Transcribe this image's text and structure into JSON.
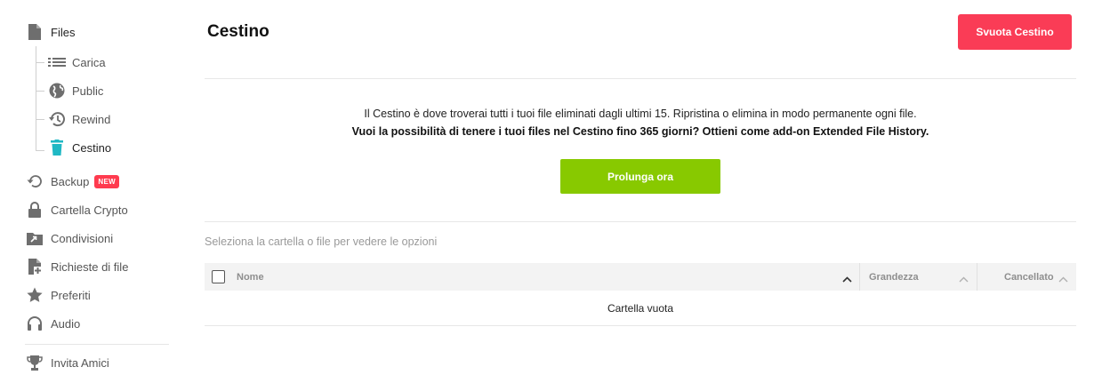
{
  "sidebar": {
    "files": {
      "label": "Files",
      "icon": "file-icon"
    },
    "sub_items": [
      {
        "label": "Carica",
        "icon": "list-icon"
      },
      {
        "label": "Public",
        "icon": "globe-icon"
      },
      {
        "label": "Rewind",
        "icon": "history-icon"
      },
      {
        "label": "Cestino",
        "icon": "trash-icon",
        "active": true
      }
    ],
    "items": [
      {
        "label": "Backup",
        "icon": "backup-icon",
        "badge": "NEW"
      },
      {
        "label": "Cartella Crypto",
        "icon": "lock-icon"
      },
      {
        "label": "Condivisioni",
        "icon": "shared-folder-icon"
      },
      {
        "label": "Richieste di file",
        "icon": "file-request-icon"
      },
      {
        "label": "Preferiti",
        "icon": "star-icon"
      },
      {
        "label": "Audio",
        "icon": "headphones-icon"
      }
    ],
    "footer": {
      "label": "Invita Amici",
      "icon": "trophy-icon"
    }
  },
  "main": {
    "title": "Cestino",
    "empty_button": "Svuota Cestino",
    "info_line1": "Il Cestino è dove troverai tutti i tuoi file eliminati dagli ultimi 15. Ripristina o elimina in modo permanente ogni file.",
    "info_line2": "Vuoi la possibilità di tenere i tuoi files nel Cestino fino 365 giorni? Ottieni come add-on Extended File History.",
    "extend_button": "Prolunga ora",
    "hint": "Seleziona la cartella o file per vedere le opzioni"
  },
  "table": {
    "columns": {
      "name": "Nome",
      "size": "Grandezza",
      "deleted": "Cancellato"
    },
    "empty_text": "Cartella vuota"
  },
  "colors": {
    "danger": "#fa3c56",
    "success": "#88c900",
    "trash_active": "#20b8c4",
    "icon": "#6e6e6e"
  }
}
